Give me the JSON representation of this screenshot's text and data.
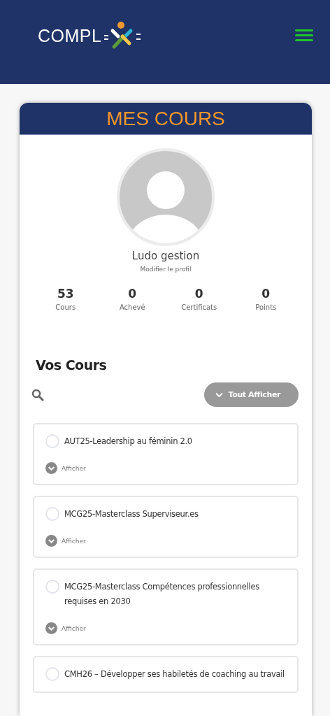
{
  "header": {
    "logo_text": "COMPL"
  },
  "panel": {
    "title": "MES COURS"
  },
  "profile": {
    "name": "Ludo gestion",
    "edit_link": "Modifier le profil"
  },
  "stats": [
    {
      "value": "53",
      "label": "Cours"
    },
    {
      "value": "0",
      "label": "Achevé"
    },
    {
      "value": "0",
      "label": "Certificats"
    },
    {
      "value": "0",
      "label": "Points"
    }
  ],
  "courses_section": {
    "title": "Vos Cours",
    "show_all_button": "Tout Afficher"
  },
  "courses": [
    {
      "title": "AUT25-Leadership au féminin 2.0",
      "completed": false,
      "toggle_label": "Afficher"
    },
    {
      "title": "MCG25-Masterclass Superviseur.es",
      "completed": false,
      "toggle_label": "Afficher"
    },
    {
      "title": "MCG25-Masterclass Compétences professionnelles requises en 2030",
      "completed": false,
      "toggle_label": "Afficher"
    },
    {
      "title": "CMH26 – Développer ses habiletés de coaching au travail",
      "completed": false
    }
  ]
}
